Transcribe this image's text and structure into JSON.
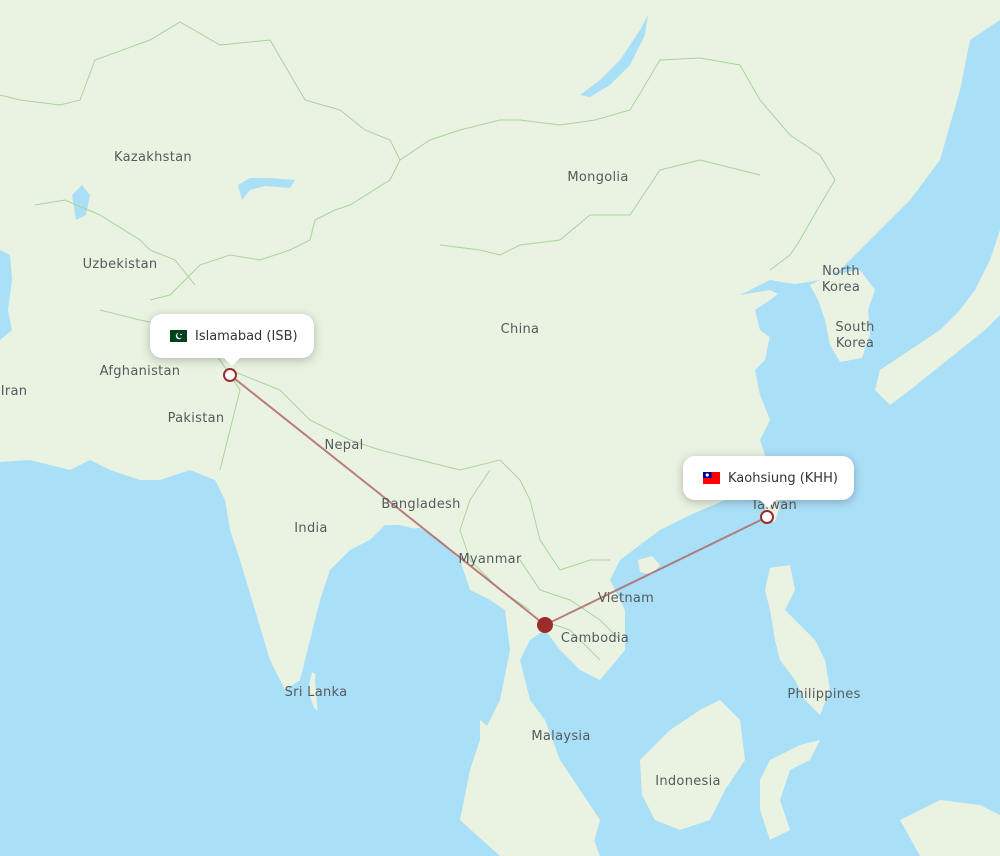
{
  "map": {
    "colors": {
      "water": "#aadff8",
      "land": "#eaf3e2",
      "border": "#a8d49a",
      "route": "#b06868",
      "marker": "#9b2c2c"
    },
    "country_labels": [
      {
        "name": "Kazakhstan"
      },
      {
        "name": "Mongolia"
      },
      {
        "name": "Uzbekistan"
      },
      {
        "name": "China"
      },
      {
        "name": "North\nKorea"
      },
      {
        "name": "South\nKorea"
      },
      {
        "name": "Iran"
      },
      {
        "name": "Afghanistan"
      },
      {
        "name": "Pakistan"
      },
      {
        "name": "Nepal"
      },
      {
        "name": "India"
      },
      {
        "name": "Bangladesh"
      },
      {
        "name": "Myanmar"
      },
      {
        "name": "Taiwan"
      },
      {
        "name": "Vietnam"
      },
      {
        "name": "Cambodia"
      },
      {
        "name": "Sri Lanka"
      },
      {
        "name": "Philippines"
      },
      {
        "name": "Malaysia"
      },
      {
        "name": "Indonesia"
      }
    ],
    "origin": {
      "label": "Islamabad (ISB)",
      "flag": "pakistan-flag"
    },
    "destination": {
      "label": "Kaohsiung (KHH)",
      "flag": "taiwan-flag"
    },
    "stopover": {
      "name": "stopover-marker"
    }
  }
}
